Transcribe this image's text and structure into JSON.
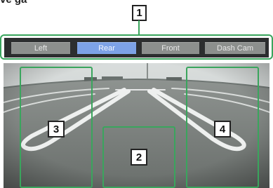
{
  "heading": "ve ga",
  "tabs": [
    {
      "label": "Left",
      "active": false
    },
    {
      "label": "Rear",
      "active": true
    },
    {
      "label": "Front",
      "active": false
    },
    {
      "label": "Dash Cam",
      "active": false
    }
  ],
  "callouts": {
    "tabs": "1",
    "center_area": "2",
    "left_area": "3",
    "right_area": "4"
  },
  "colors": {
    "callout_frame": "#3aa55d",
    "active_tab": "#7da2e6",
    "inactive_tab": "#8c8f8d",
    "tab_bar": "#2c2e2f"
  }
}
